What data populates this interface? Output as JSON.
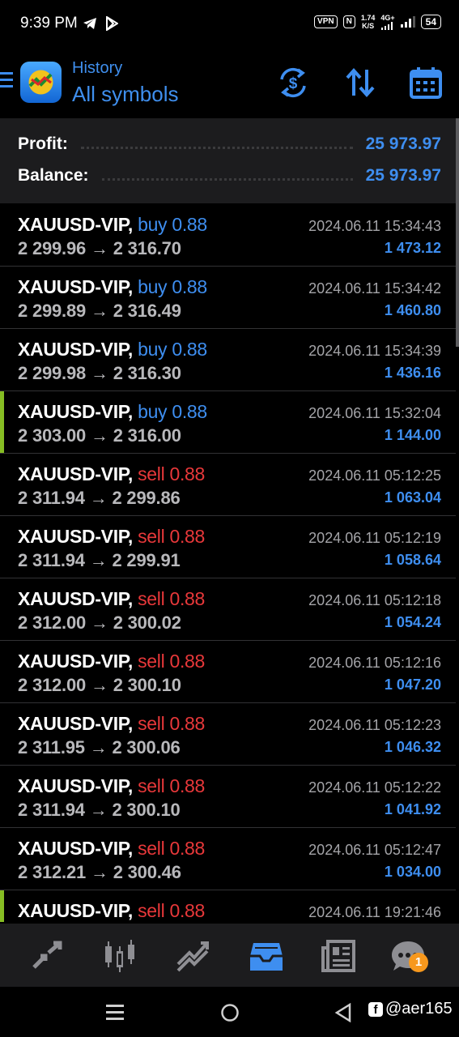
{
  "status_bar": {
    "time": "9:39 PM",
    "vpn": "VPN",
    "nfc": "N",
    "net_speed_value": "1.74",
    "net_speed_unit": "K/S",
    "network": "4G+",
    "battery": "54"
  },
  "toolbar": {
    "title": "History",
    "subtitle": "All symbols",
    "icons": [
      "menu-icon",
      "metatrader-logo",
      "currency-exchange-icon",
      "sort-icon",
      "calendar-icon"
    ],
    "accent_color": "#3e8ef0"
  },
  "summary": {
    "profit_label": "Profit:",
    "profit_value": "25 973.97",
    "balance_label": "Balance:",
    "balance_value": "25 973.97"
  },
  "trades": [
    {
      "symbol": "XAUUSD-VIP,",
      "side": "buy",
      "volume": "buy 0.88",
      "open": "2 299.96",
      "close": "2 316.70",
      "time": "2024.06.11 15:34:43",
      "profit": "1 473.12",
      "marked": false
    },
    {
      "symbol": "XAUUSD-VIP,",
      "side": "buy",
      "volume": "buy 0.88",
      "open": "2 299.89",
      "close": "2 316.49",
      "time": "2024.06.11 15:34:42",
      "profit": "1 460.80",
      "marked": false
    },
    {
      "symbol": "XAUUSD-VIP,",
      "side": "buy",
      "volume": "buy 0.88",
      "open": "2 299.98",
      "close": "2 316.30",
      "time": "2024.06.11 15:34:39",
      "profit": "1 436.16",
      "marked": false
    },
    {
      "symbol": "XAUUSD-VIP,",
      "side": "buy",
      "volume": "buy 0.88",
      "open": "2 303.00",
      "close": "2 316.00",
      "time": "2024.06.11 15:32:04",
      "profit": "1 144.00",
      "marked": true
    },
    {
      "symbol": "XAUUSD-VIP,",
      "side": "sell",
      "volume": "sell 0.88",
      "open": "2 311.94",
      "close": "2 299.86",
      "time": "2024.06.11 05:12:25",
      "profit": "1 063.04",
      "marked": false
    },
    {
      "symbol": "XAUUSD-VIP,",
      "side": "sell",
      "volume": "sell 0.88",
      "open": "2 311.94",
      "close": "2 299.91",
      "time": "2024.06.11 05:12:19",
      "profit": "1 058.64",
      "marked": false
    },
    {
      "symbol": "XAUUSD-VIP,",
      "side": "sell",
      "volume": "sell 0.88",
      "open": "2 312.00",
      "close": "2 300.02",
      "time": "2024.06.11 05:12:18",
      "profit": "1 054.24",
      "marked": false
    },
    {
      "symbol": "XAUUSD-VIP,",
      "side": "sell",
      "volume": "sell 0.88",
      "open": "2 312.00",
      "close": "2 300.10",
      "time": "2024.06.11 05:12:16",
      "profit": "1 047.20",
      "marked": false
    },
    {
      "symbol": "XAUUSD-VIP,",
      "side": "sell",
      "volume": "sell 0.88",
      "open": "2 311.95",
      "close": "2 300.06",
      "time": "2024.06.11 05:12:23",
      "profit": "1 046.32",
      "marked": false
    },
    {
      "symbol": "XAUUSD-VIP,",
      "side": "sell",
      "volume": "sell 0.88",
      "open": "2 311.94",
      "close": "2 300.10",
      "time": "2024.06.11 05:12:22",
      "profit": "1 041.92",
      "marked": false
    },
    {
      "symbol": "XAUUSD-VIP,",
      "side": "sell",
      "volume": "sell 0.88",
      "open": "2 312.21",
      "close": "2 300.46",
      "time": "2024.06.11 05:12:47",
      "profit": "1 034.00",
      "marked": false
    },
    {
      "symbol": "XAUUSD-VIP,",
      "side": "sell",
      "volume": "sell 0.88",
      "open": "",
      "close": "",
      "time": "2024.06.11 19:21:46",
      "profit": "",
      "marked": true
    }
  ],
  "bottom_nav": {
    "items": [
      "quotes-icon",
      "chart-icon",
      "trade-icon",
      "history-icon",
      "news-icon",
      "messages-icon"
    ],
    "active": "history-icon",
    "messages_badge": "1"
  },
  "watermark": {
    "handle": "@aer165"
  }
}
